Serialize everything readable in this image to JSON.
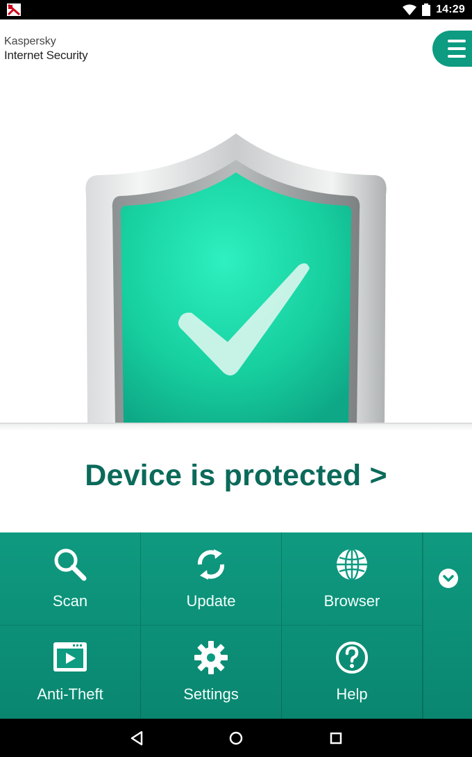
{
  "status_bar": {
    "time": "14:29"
  },
  "header": {
    "brand_line1": "Kaspersky",
    "brand_line2": "Internet Security"
  },
  "status": {
    "text": "Device is protected >"
  },
  "features": [
    {
      "label": "Scan",
      "icon": "search-icon"
    },
    {
      "label": "Update",
      "icon": "refresh-icon"
    },
    {
      "label": "Browser",
      "icon": "globe-icon"
    },
    {
      "label": "Anti-Theft",
      "icon": "anti-theft-icon"
    },
    {
      "label": "Settings",
      "icon": "gear-icon"
    },
    {
      "label": "Help",
      "icon": "help-icon"
    }
  ],
  "colors": {
    "accent": "#0d9b81",
    "status_text": "#0b6a5a",
    "shield": "#1fd6a8"
  }
}
